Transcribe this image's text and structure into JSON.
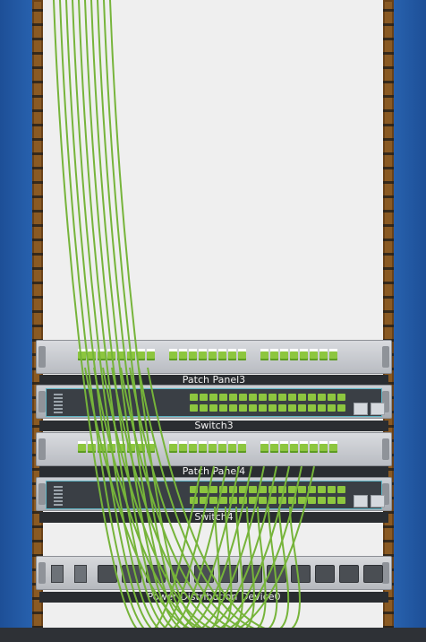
{
  "devices": {
    "patch_panel_3": {
      "label": "Patch Panel3"
    },
    "switch_3": {
      "label": "Switch3"
    },
    "patch_panel_4": {
      "label": "Patch Panel4"
    },
    "switch_4": {
      "label": "Switch4"
    },
    "pdu_0": {
      "label": "Power Distribution Device0"
    }
  },
  "colors": {
    "cable": "#76b43a",
    "rack_blue": "#1f57a3",
    "rail_brown": "#8a5a23"
  }
}
